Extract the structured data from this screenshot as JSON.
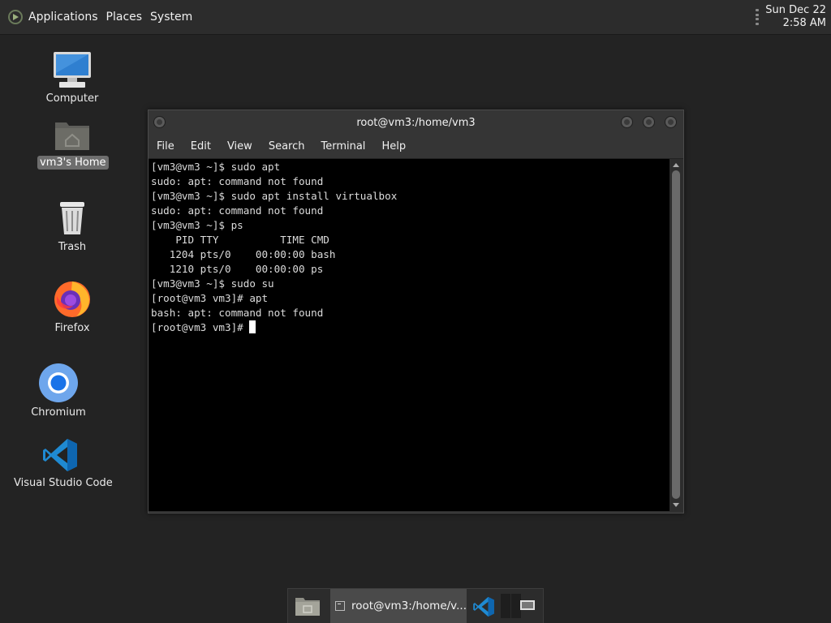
{
  "top_panel": {
    "menus": [
      "Applications",
      "Places",
      "System"
    ],
    "icons": {
      "logo": "gnome-foot-icon",
      "grip": "panel-grip-icon"
    },
    "clock": {
      "date": "Sun Dec 22",
      "time": "2:58 AM"
    }
  },
  "desktop": {
    "icons": [
      {
        "label": "Computer",
        "icon": "computer-icon"
      },
      {
        "label": "vm3's Home",
        "icon": "home-folder-icon",
        "selected": true
      },
      {
        "label": "Trash",
        "icon": "trash-icon"
      },
      {
        "label": "Firefox",
        "icon": "firefox-icon"
      },
      {
        "label": "Chromium",
        "icon": "chromium-icon"
      },
      {
        "label": "Visual Studio Code",
        "icon": "vscode-icon"
      }
    ]
  },
  "terminal": {
    "title": "root@vm3:/home/vm3",
    "menu": [
      "File",
      "Edit",
      "View",
      "Search",
      "Terminal",
      "Help"
    ],
    "lines": [
      "[vm3@vm3 ~]$ sudo apt",
      "sudo: apt: command not found",
      "[vm3@vm3 ~]$ sudo apt install virtualbox",
      "sudo: apt: command not found",
      "[vm3@vm3 ~]$ ps",
      "    PID TTY          TIME CMD",
      "   1204 pts/0    00:00:00 bash",
      "   1210 pts/0    00:00:00 ps",
      "[vm3@vm3 ~]$ sudo su",
      "[root@vm3 vm3]# apt",
      "bash: apt: command not found"
    ],
    "prompt": "[root@vm3 vm3]# "
  },
  "taskbar": {
    "terminal_task": "root@vm3:/home/v...",
    "icons": {
      "files": "files-icon",
      "code": "vscode-icon",
      "workspace": "workspace-switcher-icon"
    }
  },
  "colors": {
    "desktop_bg": "#232323",
    "panel_bg": "#2c2c2c",
    "terminal_bg": "#000000",
    "terminal_fg": "#dcdcdc",
    "selection_bg": "#6e6e6e"
  }
}
